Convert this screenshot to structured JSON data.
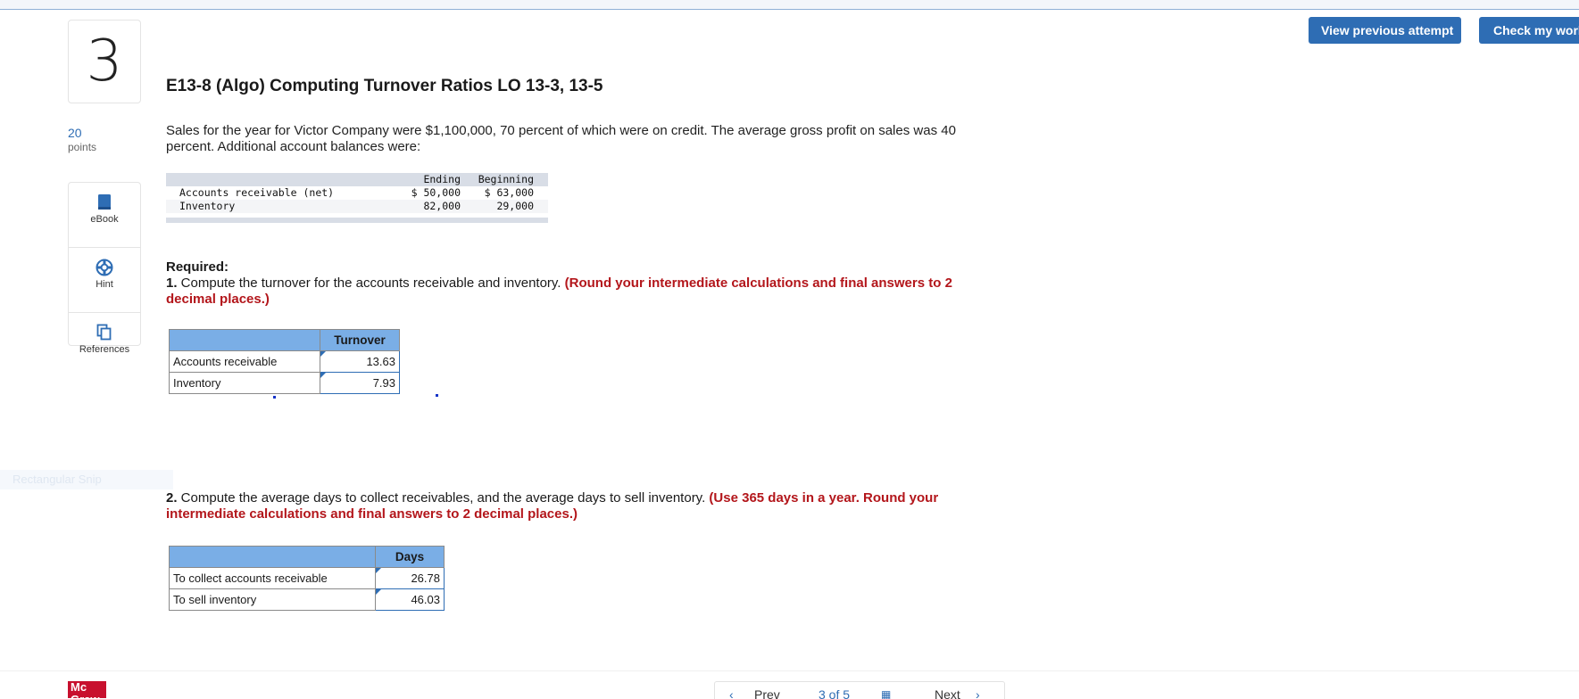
{
  "header": {
    "view_previous_attempt": "View previous attempt",
    "check_my_work": "Check my work"
  },
  "question": {
    "number": "3",
    "points_value": "20",
    "points_label": "points",
    "title": "E13-8 (Algo) Computing Turnover Ratios LO 13-3, 13-5",
    "intro": "Sales for the year for Victor Company were $1,100,000, 70 percent of which were on credit. The average gross profit on sales was 40 percent. Additional account balances were:"
  },
  "tools": [
    {
      "label": "eBook",
      "icon": "ebook-icon"
    },
    {
      "label": "Hint",
      "icon": "hint-icon"
    },
    {
      "label": "References",
      "icon": "references-icon"
    }
  ],
  "accounts_table": {
    "headers": [
      "",
      "Ending",
      "Beginning"
    ],
    "rows": [
      [
        "Accounts receivable (net)",
        "$ 50,000",
        "$ 63,000"
      ],
      [
        "Inventory",
        "82,000",
        "29,000"
      ]
    ]
  },
  "part1": {
    "required": "Required:",
    "num": "1.",
    "text": " Compute the turnover for the accounts receivable and inventory. ",
    "note": "(Round your intermediate calculations and final answers to 2 decimal places.)",
    "table": {
      "header": "Turnover",
      "rows": [
        {
          "label": "Accounts receivable",
          "value": "13.63"
        },
        {
          "label": "Inventory",
          "value": "7.93"
        }
      ]
    }
  },
  "part2": {
    "num": "2.",
    "text": " Compute the average days to collect receivables, and the average days to sell inventory. ",
    "note": "(Use 365 days in a year. Round your intermediate calculations and final answers to 2 decimal places.)",
    "table": {
      "header": "Days",
      "rows": [
        {
          "label": "To collect accounts receivable",
          "value": "26.78"
        },
        {
          "label": "To sell inventory",
          "value": "46.03"
        }
      ]
    }
  },
  "watermark": "Rectangular Snip",
  "footer": {
    "logo": "Mc Graw",
    "prev": "Prev",
    "page": "3 of 5",
    "next": "Next"
  },
  "colors": {
    "accent": "#2e6db4",
    "instruction_red": "#b3161b",
    "table_header": "#7aaee6"
  }
}
